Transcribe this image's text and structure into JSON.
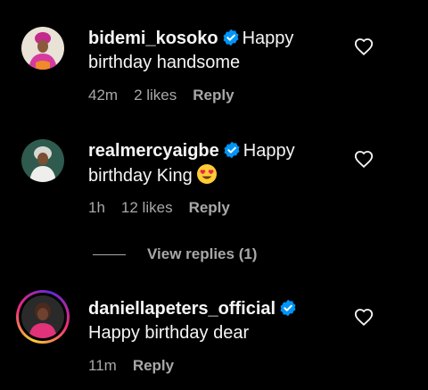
{
  "comments": [
    {
      "username": "bidemi_kosoko",
      "verified": true,
      "text_line1": "Happy",
      "text_line2": "birthday handsome",
      "time": "42m",
      "likes": "2 likes",
      "reply_label": "Reply"
    },
    {
      "username": "realmercyaigbe",
      "verified": true,
      "text_line1": "Happy",
      "text_line2": "birthday King",
      "emoji": "smiling-face-with-heart-eyes",
      "time": "1h",
      "likes": "12 likes",
      "reply_label": "Reply",
      "view_replies_label": "View replies (1)"
    },
    {
      "username": "daniellapeters_official",
      "verified": true,
      "text_line2": "Happy birthday dear",
      "time": "11m",
      "reply_label": "Reply",
      "has_story_ring": true
    }
  ],
  "colors": {
    "background": "#000000",
    "text": "#f5f5f5",
    "secondary": "#a8a8a8",
    "verified": "#0095f6"
  }
}
